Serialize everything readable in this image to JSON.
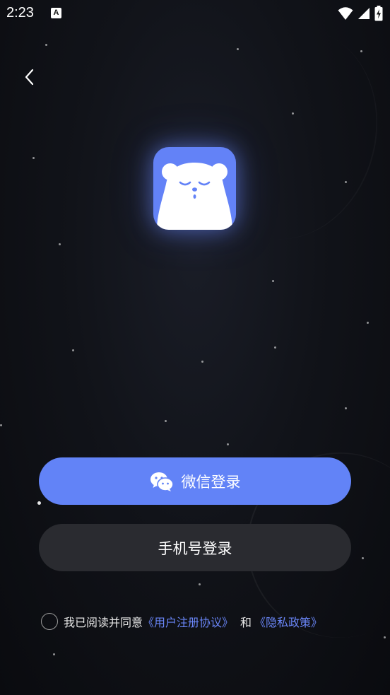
{
  "status_bar": {
    "time": "2:23",
    "notification_letter": "A"
  },
  "colors": {
    "accent": "#6283f7",
    "phone_button_bg": "#2a2b30",
    "link": "#6a86f8",
    "background": "#0f1116"
  },
  "icons": {
    "back": "chevron-left-icon",
    "logo": "bear-logo-icon",
    "wechat": "wechat-icon",
    "wifi": "wifi-icon",
    "signal": "signal-icon",
    "battery": "battery-icon"
  },
  "login": {
    "wechat_label": "微信登录",
    "phone_label": "手机号登录"
  },
  "agreement": {
    "prefix": "我已阅读并同意",
    "terms_link": "《用户注册协议》",
    "and_text": "和",
    "privacy_link": "《隐私政策》",
    "checked": false
  }
}
